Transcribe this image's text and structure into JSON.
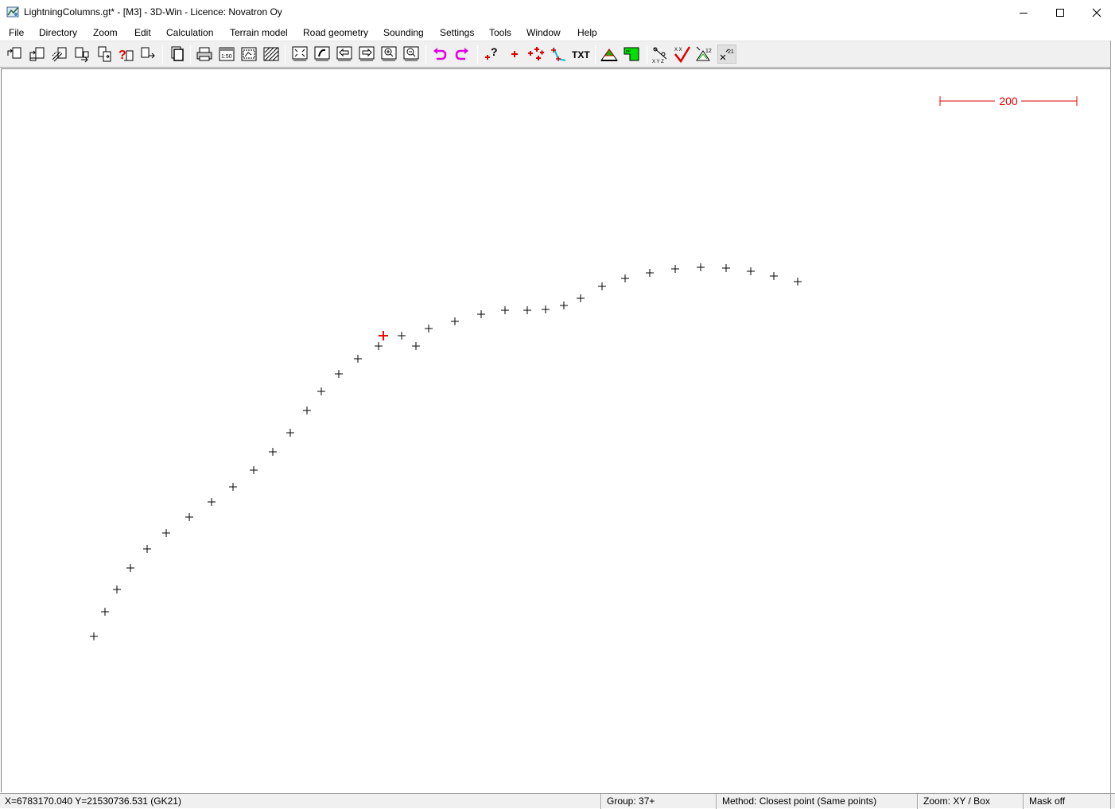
{
  "window": {
    "title": "LightningColumns.gt* - [M3] - 3D-Win - Licence: Novatron Oy",
    "controls": [
      "minimize-icon",
      "maximize-icon",
      "close-icon"
    ]
  },
  "menu": [
    "File",
    "Directory",
    "Zoom",
    "Edit",
    "Calculation",
    "Terrain model",
    "Road geometry",
    "Sounding",
    "Settings",
    "Tools",
    "Window",
    "Help"
  ],
  "toolbar": {
    "buttons": [
      "open-file-icon",
      "save-file-icon",
      "edit-file-icon",
      "export-icon",
      "import-icon",
      "query-file-icon",
      "convert-icon",
      "copy-icon",
      "print-icon",
      "scale-print-icon",
      "plot-icon",
      "hatch-icon",
      "zoom-all-icon",
      "zoom-window-icon",
      "pan-left-icon",
      "pan-right-icon",
      "zoom-in-icon",
      "zoom-out-icon",
      "undo-icon",
      "redo-icon",
      "point-info-icon",
      "add-point-icon",
      "add-points-icon",
      "line-icon",
      "text-icon",
      "terrain-icon",
      "area-icon",
      "xyz-icon",
      "check-icon",
      "number-icon",
      "label-toggle-icon"
    ],
    "text_button_label": "TXT",
    "accent_colors": {
      "red": "#ff0000",
      "magenta": "#e000e0",
      "green": "#00c000",
      "cyan": "#00c0e0"
    }
  },
  "canvas": {
    "scale_bar_label": "200",
    "scale_bar_color": "#e00000",
    "point_color": "#000000",
    "selected_point_color": "#ff0000",
    "point_count": 38,
    "selected_point_count": 1
  },
  "statusbar": {
    "coords": "X=6783170.040  Y=21530736.531   (GK21)",
    "group": "Group: 37+",
    "method": "Method: Closest point (Same points)",
    "zoom": "Zoom: XY  /  Box",
    "mask": "Mask off"
  }
}
